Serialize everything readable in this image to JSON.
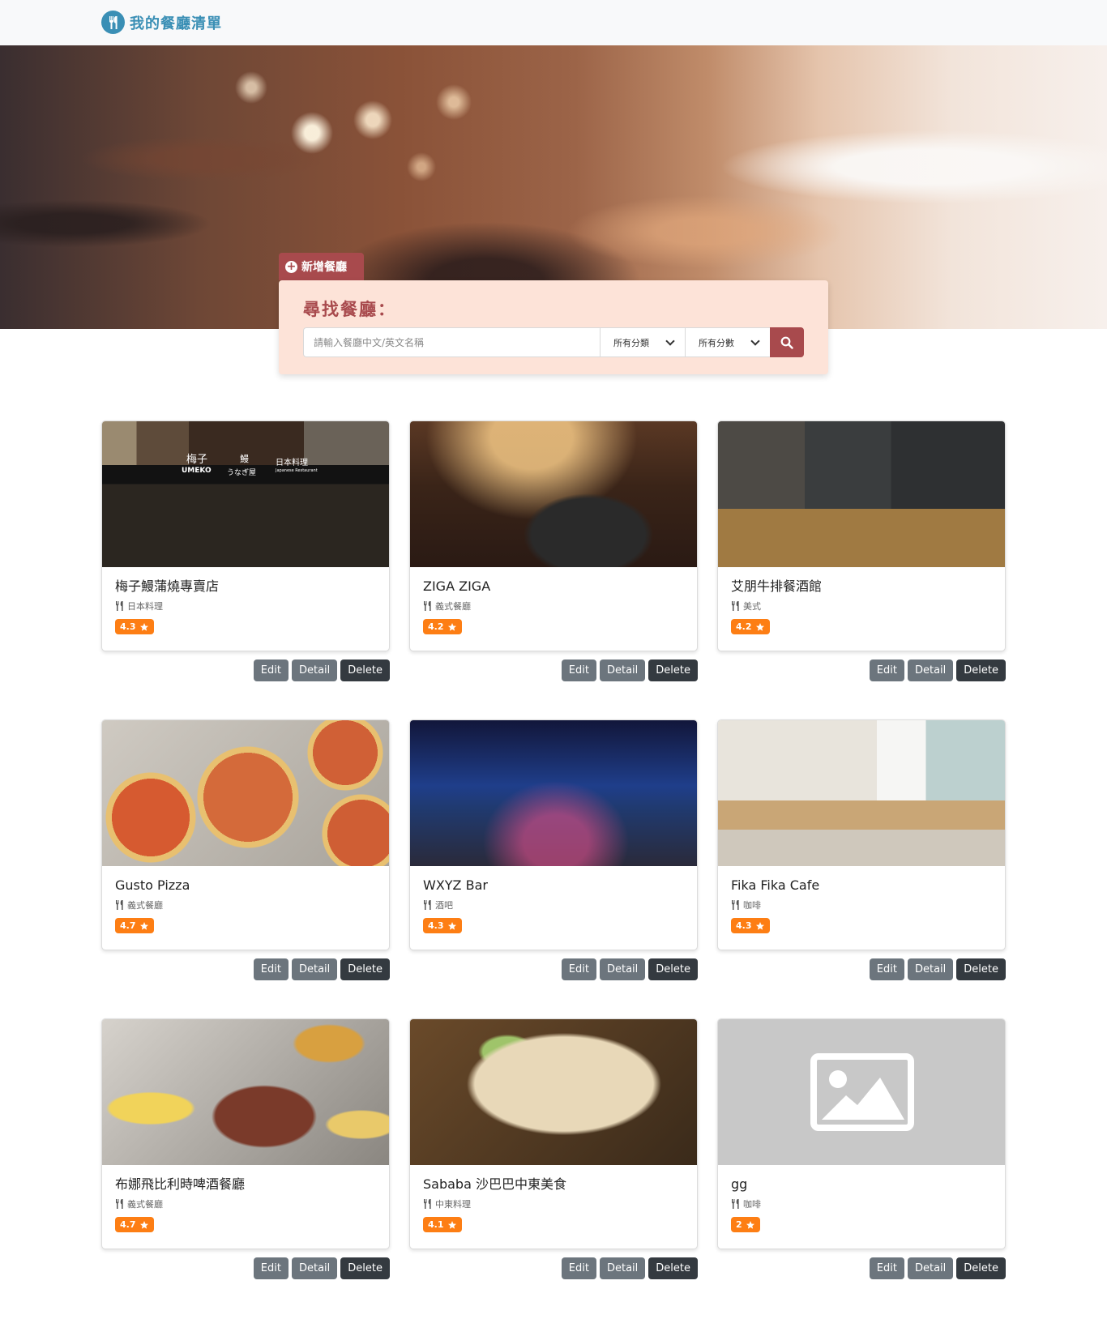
{
  "brand": {
    "title": "我的餐廳清單",
    "icon": "utensils-icon",
    "color": "#3a8fb5"
  },
  "add_button": {
    "label": "新增餐廳",
    "icon": "plus-circle-icon"
  },
  "search": {
    "title": "尋找餐廳：",
    "placeholder": "請輸入餐廳中文/英文名稱",
    "category_select": "所有分類",
    "score_select": "所有分數",
    "button_icon": "search-icon",
    "accent": "#a84a4d"
  },
  "buttons": {
    "edit": "Edit",
    "detail": "Detail",
    "delete": "Delete"
  },
  "restaurants": [
    {
      "name": "梅子鰻蒲燒專賣店",
      "category": "日本料理",
      "rating": "4.3"
    },
    {
      "name": "ZIGA ZIGA",
      "category": "義式餐廳",
      "rating": "4.2"
    },
    {
      "name": "艾朋牛排餐酒館",
      "category": "美式",
      "rating": "4.2"
    },
    {
      "name": "Gusto Pizza",
      "category": "義式餐廳",
      "rating": "4.7"
    },
    {
      "name": "WXYZ Bar",
      "category": "酒吧",
      "rating": "4.3"
    },
    {
      "name": "Fika Fika Cafe",
      "category": "咖啡",
      "rating": "4.3"
    },
    {
      "name": "布娜飛比利時啤酒餐廳",
      "category": "義式餐廳",
      "rating": "4.7"
    },
    {
      "name": "Sababa 沙巴巴中東美食",
      "category": "中東料理",
      "rating": "4.1"
    },
    {
      "name": "gg",
      "category": "咖啡",
      "rating": "2"
    }
  ],
  "umeko_sign": {
    "top": "梅子",
    "sub": "UMEKO",
    "eel": "鰻",
    "kana": "うなぎ屋",
    "jp": "日本料理",
    "en": "Japanese Restaurant"
  },
  "rating_color": "#fd7e14"
}
